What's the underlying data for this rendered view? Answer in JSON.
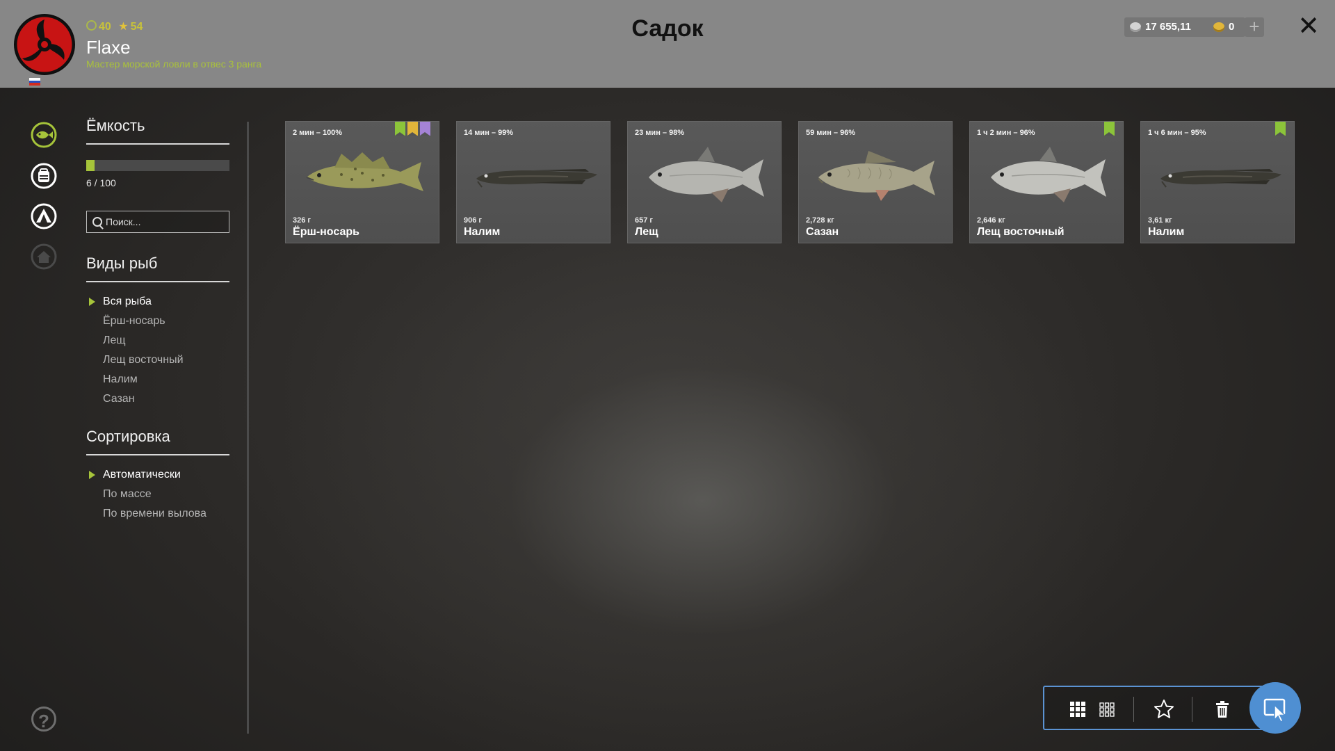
{
  "header": {
    "title": "Садок",
    "player": {
      "xp_level": "40",
      "star_level": "54",
      "username": "Flaxe",
      "rank": "Мастер морской ловли в отвес 3 ранга"
    },
    "currency": {
      "silver": "17 655,11",
      "gold": "0",
      "add_label": "+"
    },
    "close_label": "✕"
  },
  "sidebar": {
    "icons": [
      "keepnet-icon",
      "backpack-icon",
      "camp-icon",
      "home-icon"
    ],
    "help_label": "?"
  },
  "filter": {
    "capacity": {
      "title": "Ёмкость",
      "text": "6 / 100",
      "used": 6,
      "max": 100
    },
    "search": {
      "placeholder": "Поиск..."
    },
    "species": {
      "title": "Виды рыб",
      "items": [
        "Вся рыба",
        "Ёрш-носарь",
        "Лещ",
        "Лещ восточный",
        "Налим",
        "Сазан"
      ],
      "selected": 0
    },
    "sort": {
      "title": "Сортировка",
      "items": [
        "Автоматически",
        "По массе",
        "По времени вылова"
      ],
      "selected": 0
    }
  },
  "fish": [
    {
      "meta": "2 мин – 100%",
      "weight": "326 г",
      "name": "Ёрш-носарь",
      "species": "ruffe",
      "badges": [
        "#8cc43a",
        "#e1b63a",
        "#a583d6"
      ]
    },
    {
      "meta": "14 мин – 99%",
      "weight": "906 г",
      "name": "Налим",
      "species": "burbot",
      "badges": []
    },
    {
      "meta": "23 мин – 98%",
      "weight": "657 г",
      "name": "Лещ",
      "species": "bream",
      "badges": []
    },
    {
      "meta": "59 мин – 96%",
      "weight": "2,728 кг",
      "name": "Сазан",
      "species": "carp",
      "badges": []
    },
    {
      "meta": "1 ч 2 мин – 96%",
      "weight": "2,646 кг",
      "name": "Лещ восточный",
      "species": "bream-eastern",
      "badges": [
        "#8cc43a"
      ]
    },
    {
      "meta": "1 ч 6 мин – 95%",
      "weight": "3,61 кг",
      "name": "Налим",
      "species": "burbot",
      "badges": [
        "#8cc43a"
      ]
    }
  ],
  "toolbar": {
    "buttons": [
      "grid-large-icon",
      "grid-small-icon",
      "favorite-icon",
      "trash-icon",
      "select-cursor-icon"
    ]
  },
  "colors": {
    "accent_green": "#a6c43a",
    "accent_blue": "#4f8fd2",
    "header_bg": "#878787"
  }
}
